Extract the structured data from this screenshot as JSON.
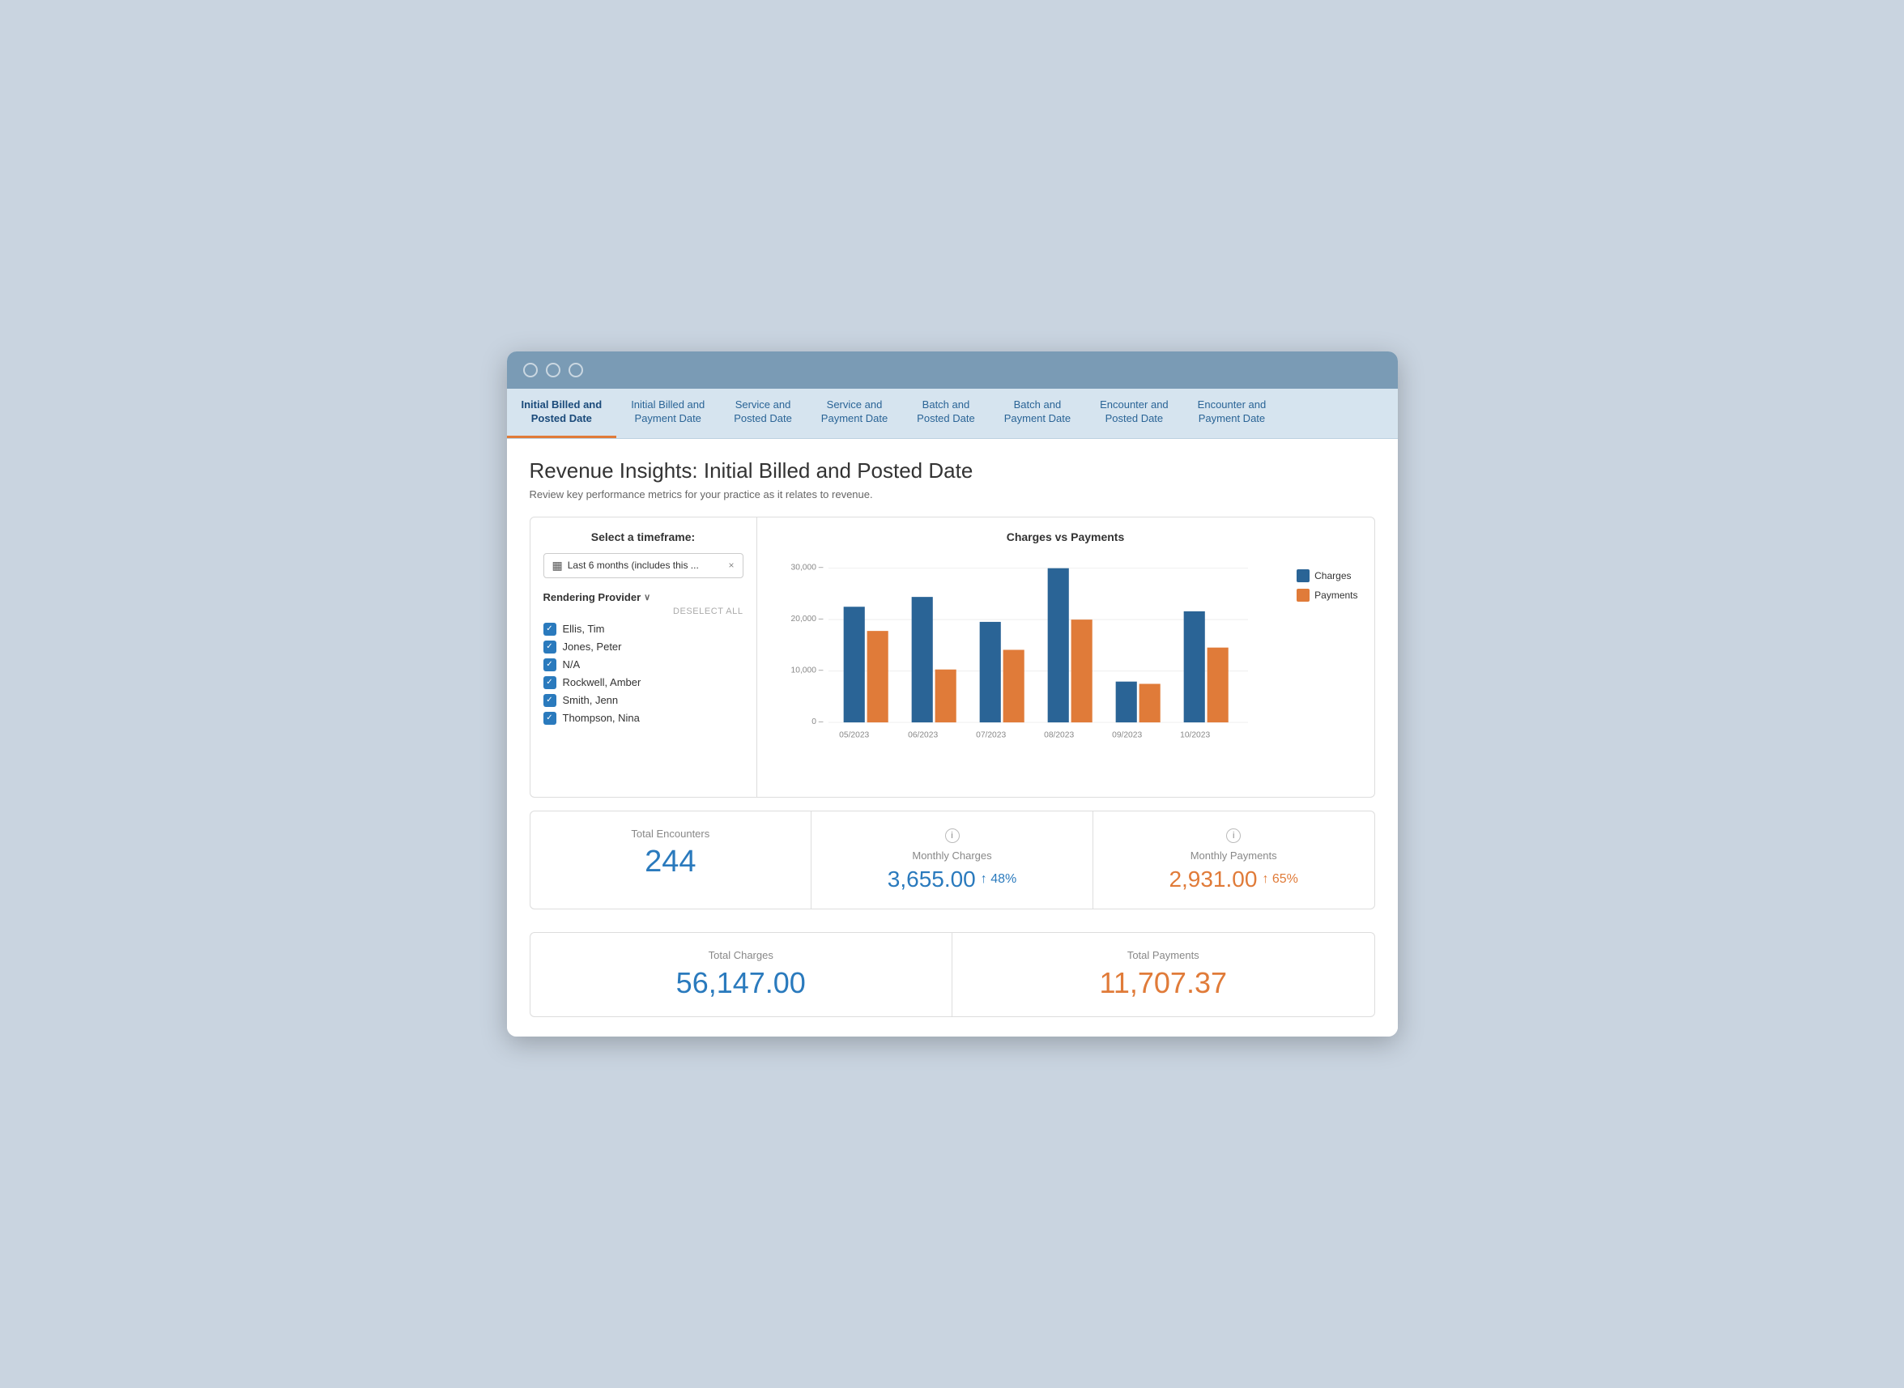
{
  "window": {
    "title": "Revenue Insights"
  },
  "tabs": [
    {
      "id": "tab1",
      "label": "Initial Billed and\nPosted Date",
      "active": true
    },
    {
      "id": "tab2",
      "label": "Initial Billed and\nPayment Date",
      "active": false
    },
    {
      "id": "tab3",
      "label": "Service and\nPosted Date",
      "active": false
    },
    {
      "id": "tab4",
      "label": "Service and\nPayment Date",
      "active": false
    },
    {
      "id": "tab5",
      "label": "Batch and\nPosted Date",
      "active": false
    },
    {
      "id": "tab6",
      "label": "Batch and\nPayment Date",
      "active": false
    },
    {
      "id": "tab7",
      "label": "Encounter and\nPosted Date",
      "active": false
    },
    {
      "id": "tab8",
      "label": "Encounter and\nPayment Date",
      "active": false
    }
  ],
  "page": {
    "title": "Revenue Insights: Initial Billed and Posted Date",
    "subtitle": "Review key performance metrics for your practice as it relates to revenue."
  },
  "filter": {
    "label": "Select a timeframe:",
    "timeframe_value": "Last 6 months (includes this ...",
    "timeframe_icon": "📅",
    "provider_label": "Rendering Provider",
    "deselect_all": "DESELECT ALL",
    "providers": [
      {
        "name": "Ellis, Tim",
        "checked": true
      },
      {
        "name": "Jones, Peter",
        "checked": true
      },
      {
        "name": "N/A",
        "checked": true
      },
      {
        "name": "Rockwell, Amber",
        "checked": true
      },
      {
        "name": "Smith, Jenn",
        "checked": true
      },
      {
        "name": "Thompson, Nina",
        "checked": true
      }
    ]
  },
  "chart": {
    "title": "Charges vs Payments",
    "legend": {
      "charges_label": "Charges",
      "payments_label": "Payments",
      "charges_color": "#2a6496",
      "payments_color": "#e07b39"
    },
    "y_axis": [
      "30,000 –",
      "20,000 –",
      "10,000 –",
      "0 –"
    ],
    "months": [
      "05/2023",
      "06/2023",
      "07/2023",
      "08/2023",
      "09/2023",
      "10/2023"
    ],
    "charges_data": [
      24000,
      26000,
      21000,
      32000,
      8500,
      23000
    ],
    "payments_data": [
      19000,
      11000,
      15000,
      20000,
      8000,
      15500
    ]
  },
  "stats": {
    "total_encounters_label": "Total Encounters",
    "total_encounters_value": "244",
    "monthly_charges_label": "Monthly Charges",
    "monthly_charges_value": "3,655.00",
    "monthly_charges_change": "↑ 48%",
    "monthly_payments_label": "Monthly Payments",
    "monthly_payments_value": "2,931.00",
    "monthly_payments_change": "↑ 65%"
  },
  "totals": {
    "charges_label": "Total Charges",
    "charges_value": "56,147.00",
    "payments_label": "Total Payments",
    "payments_value": "11,707.37"
  },
  "icons": {
    "checkmark": "✓",
    "info": "i",
    "calendar": "▦",
    "close": "×",
    "chevron": "∨"
  }
}
